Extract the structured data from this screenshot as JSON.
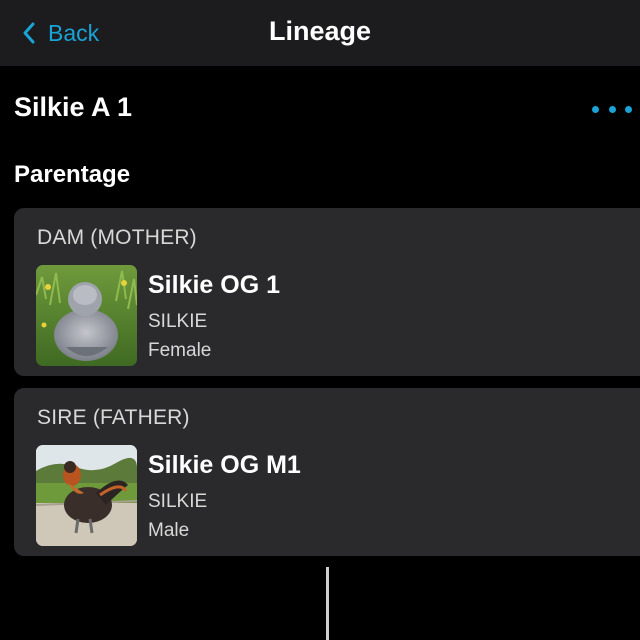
{
  "nav": {
    "back_label": "Back",
    "title": "Lineage"
  },
  "animal": {
    "name": "Silkie A 1"
  },
  "parentage": {
    "section_title": "Parentage",
    "dam": {
      "label": "DAM (MOTHER)",
      "name": "Silkie OG 1",
      "breed": "SILKIE",
      "sex": "Female"
    },
    "sire": {
      "label": "SIRE (FATHER)",
      "name": "Silkie OG M1",
      "breed": "SILKIE",
      "sex": "Male"
    }
  },
  "colors": {
    "accent": "#1aa3d6",
    "background": "#000000",
    "navbar": "#1c1c1e",
    "card": "#2a2a2c"
  },
  "icons": {
    "back": "chevron-left-icon",
    "more": "more-horizontal-icon"
  }
}
